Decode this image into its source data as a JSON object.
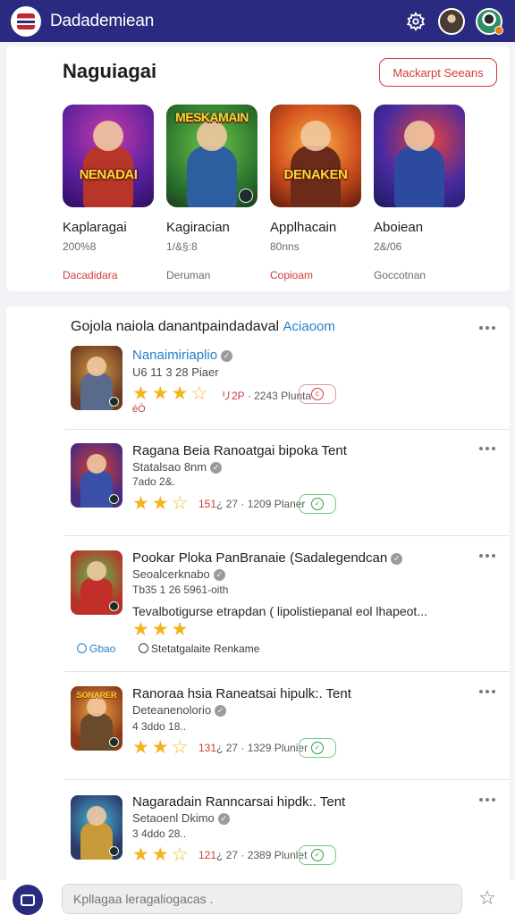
{
  "app": {
    "title": "Dadademiean"
  },
  "featured": {
    "title": "Naguiagai",
    "button_label": "Mackarpt Seeans",
    "cards": [
      {
        "thumb_text": "NENADAI",
        "name": "Kaplaragai",
        "meta": "200%8",
        "tag": "Dacadidara",
        "tag_color": "red"
      },
      {
        "thumb_text": "MESKAMAIN",
        "name": "Kagiracian",
        "meta": "1/&§:8",
        "tag": "Deruman",
        "tag_color": "gray"
      },
      {
        "thumb_text": "DENAKEN",
        "name": "Applhacain",
        "meta": "80nns",
        "tag": "Copioam",
        "tag_color": "red"
      },
      {
        "thumb_text": "",
        "name": "Aboiean",
        "meta": "2&/06",
        "tag": "Goccotnan",
        "tag_color": "gray"
      }
    ]
  },
  "list": {
    "header": "Gojola naiola danantpaindadaval",
    "header_accent": "Aciaoom",
    "rows": [
      {
        "icon_label": "",
        "title": "Nanaimiriaplio",
        "title_style": "link",
        "sub": "U6 11 3 28 Piaer",
        "stars": [
          1,
          1,
          1,
          0
        ],
        "rating_num": "リ2P",
        "rating_rest": " · 2243 Plunta",
        "pill": "red",
        "pill_text": "",
        "extra": "éŌ"
      },
      {
        "icon_label": "",
        "title": "Ragana Beia Ranoatgai bipoka Tent",
        "title_style": "normal",
        "sub": "Statalsao 8nm",
        "meta": "7ado  2&.",
        "stars": [
          1,
          1,
          0
        ],
        "rating_num": "151",
        "rating_rest": "¿ 27 · 1209 Planer",
        "pill": "green",
        "pill_text": ""
      },
      {
        "icon_label": "",
        "title": "Pookar Ploka PanBranaie (Sadalegendcan",
        "title_style": "normal",
        "sub": "Seoalcerknabo",
        "meta": "Tb35 1 26 5961-oith",
        "desc": "Tevalbotigurse etrapdan ( lipolistiepanal eol lhapeot...",
        "stars": [
          1,
          1,
          1
        ],
        "chip_blue": "Gbao",
        "chip_dark": "Stetatgalaite Renkame"
      },
      {
        "icon_label": "SONARER",
        "title": "Ranoraa hsia Raneatsai hipulk:. Tent",
        "title_style": "normal",
        "sub": "Deteanenolorio",
        "meta": "4 3ddo  18..",
        "stars": [
          1,
          1,
          0
        ],
        "rating_num": "131",
        "rating_rest": "¿ 27 · 1329 Plunier",
        "pill": "green",
        "pill_text": ""
      },
      {
        "icon_label": "",
        "title": "Nagaradain Ranncarsai hipdk:. Tent",
        "title_style": "normal",
        "sub": "Setaoenl Dkimo",
        "meta": "3 4ddo  28..",
        "stars": [
          1,
          1,
          0
        ],
        "rating_num": "121",
        "rating_rest": "¿ 27 · 2389 Plunlet",
        "pill": "green",
        "pill_text": ""
      }
    ]
  },
  "search": {
    "placeholder": "Kpllagaa leragaliogacas ."
  },
  "colors": {
    "primary": "#2a2b80",
    "accent": "#2780c9",
    "danger": "#d23a3a",
    "star": "#f2b418",
    "success": "#2aa04a"
  },
  "icons": {
    "logo": "book-logo-icon",
    "settings": "gear-icon",
    "more": "more-dots-icon",
    "verified": "verified-icon",
    "compose": "compose-icon",
    "favorite": "star-outline-icon"
  }
}
